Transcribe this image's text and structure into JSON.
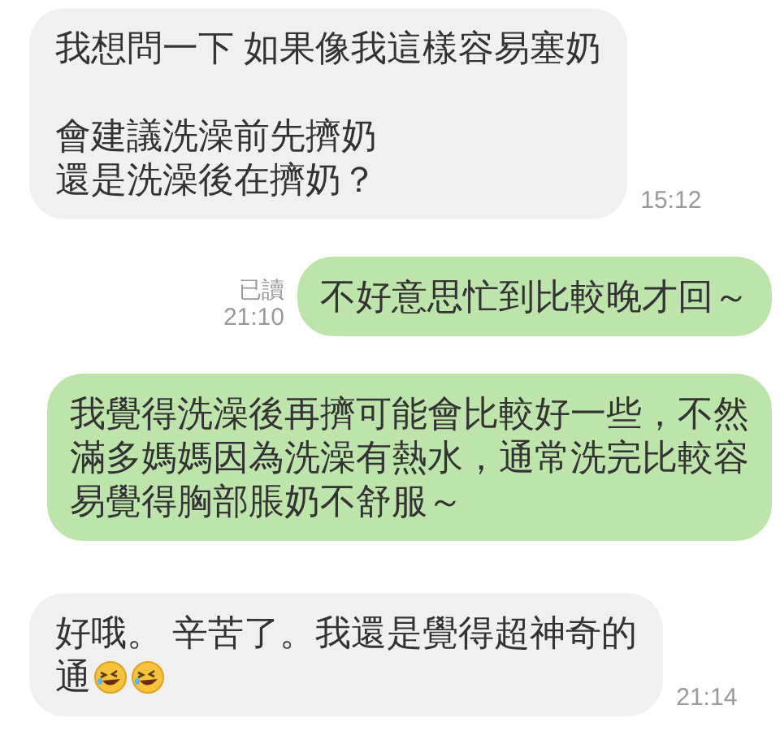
{
  "messages": [
    {
      "kind": "incoming",
      "paragraphs": [
        [
          "我想問一下 如果像我這樣容易塞奶"
        ],
        [
          "會建議洗澡前先擠奶",
          "還是洗澡後在擠奶？"
        ]
      ],
      "time": "15:12"
    },
    {
      "kind": "outgoing",
      "paragraphs": [
        [
          "不好意思忙到比較晚才回～"
        ]
      ],
      "read_label": "已讀",
      "time": "21:10"
    },
    {
      "kind": "outgoing",
      "paragraphs": [
        [
          "我覺得洗澡後再擠可能會比較好一些，不然",
          "滿多媽媽因為洗澡有熱水，通常洗完比較容",
          "易覺得胸部脹奶不舒服～"
        ]
      ]
    },
    {
      "kind": "incoming",
      "paragraphs": [
        [
          "好哦。 辛苦了。我還是覺得超神奇的",
          "通"
        ]
      ],
      "emoji": [
        {
          "kind": "laughing"
        },
        {
          "kind": "laughing"
        }
      ],
      "time": "21:14"
    }
  ]
}
